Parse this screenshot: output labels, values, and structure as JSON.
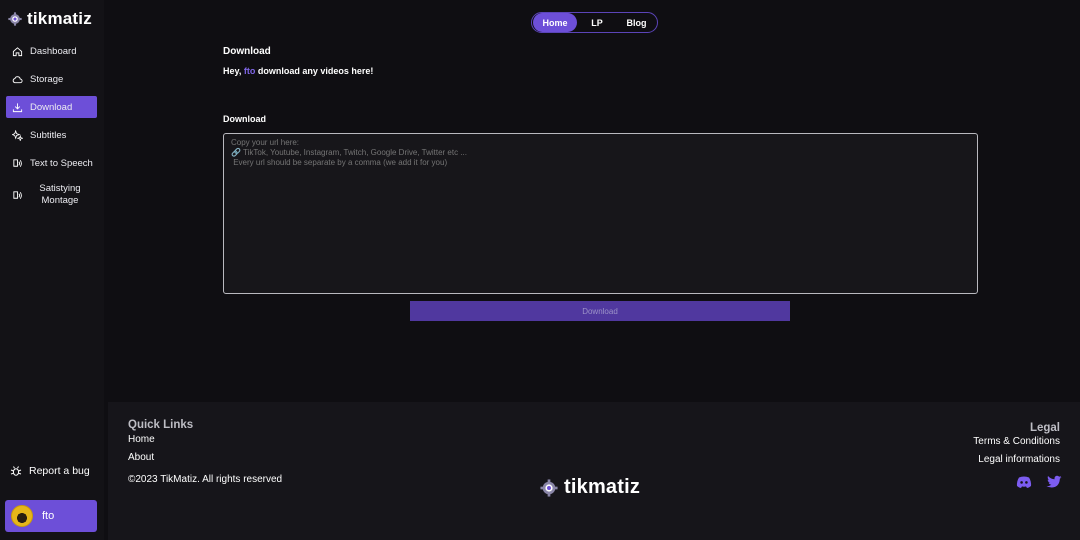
{
  "brand": {
    "name": "tikmatiz",
    "accent": "#6d4fd8",
    "link_color": "#7f66e6"
  },
  "sidebar": {
    "items": [
      {
        "label": "Dashboard",
        "icon": "home-icon"
      },
      {
        "label": "Storage",
        "icon": "cloud-icon"
      },
      {
        "label": "Download",
        "icon": "download-icon",
        "active": true
      },
      {
        "label": "Subtitles",
        "icon": "sparkles-icon"
      },
      {
        "label": "Text to Speech",
        "icon": "speech-icon"
      },
      {
        "label": "Satistying Montage",
        "icon": "montage-icon"
      }
    ],
    "report_bug": "Report a bug",
    "user": {
      "name": "fto"
    }
  },
  "tabs": [
    {
      "label": "Home",
      "active": true
    },
    {
      "label": "LP"
    },
    {
      "label": "Blog"
    }
  ],
  "main": {
    "title": "Download",
    "greeting_prefix": "Hey,",
    "greeting_user": "fto",
    "greeting_suffix": "download any videos here!",
    "section_label": "Download",
    "url_placeholder": "Copy your url here:\n🔗 TikTok, Youtube, Instagram, Twitch, Google Drive, Twitter etc ...\n Every url should be separate by a comma (we add it for you)",
    "download_button": "Download"
  },
  "footer": {
    "quick_links_title": "Quick Links",
    "quick_links": [
      "Home",
      "About"
    ],
    "copyright": "©2023 TikMatiz. All rights reserved",
    "legal_title": "Legal",
    "legal_links": [
      "Terms & Conditions",
      "Legal informations"
    ],
    "socials": [
      "discord-icon",
      "twitter-icon"
    ]
  }
}
